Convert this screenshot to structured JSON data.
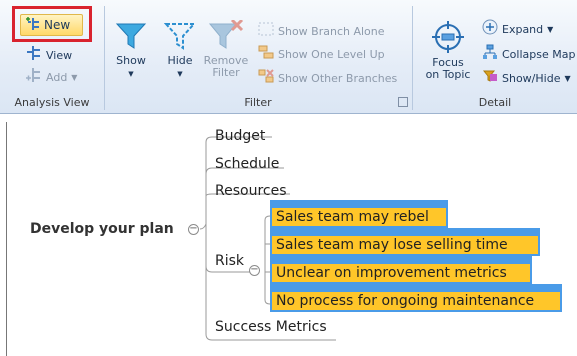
{
  "ribbon": {
    "analysis_view": {
      "new_label": "New",
      "view_label": "View",
      "add_label": "Add",
      "group_label": "Analysis View"
    },
    "filter": {
      "show_label": "Show",
      "hide_label": "Hide",
      "remove_filter_line1": "Remove",
      "remove_filter_line2": "Filter",
      "show_branch_alone": "Show Branch Alone",
      "show_one_level_up": "Show One Level Up",
      "show_other_branches": "Show Other Branches",
      "group_label": "Filter"
    },
    "detail": {
      "focus_line1": "Focus",
      "focus_line2": "on Topic",
      "expand_label": "Expand",
      "collapse_label": "Collapse Map",
      "show_hide_label": "Show/Hide",
      "group_label": "Detail"
    }
  },
  "map": {
    "central_topic": "Develop your plan",
    "branches": [
      "Budget",
      "Schedule",
      "Resources",
      "Risk",
      "Success Metrics"
    ],
    "risk_subtopics": [
      "Sales team may rebel",
      "Sales team may lose selling time",
      "Unclear on improvement metrics",
      "No process for ongoing maintenance"
    ]
  },
  "colors": {
    "ribbon_bg": "#dbe6f4",
    "highlight_red": "#d9232e",
    "topic_fill": "#ffc629",
    "topic_border": "#4a9be8"
  },
  "icons": {
    "new": "new-view-icon",
    "show": "funnel-icon",
    "hide": "funnel-outline-icon",
    "remove_filter": "funnel-remove-icon",
    "focus": "target-icon"
  }
}
